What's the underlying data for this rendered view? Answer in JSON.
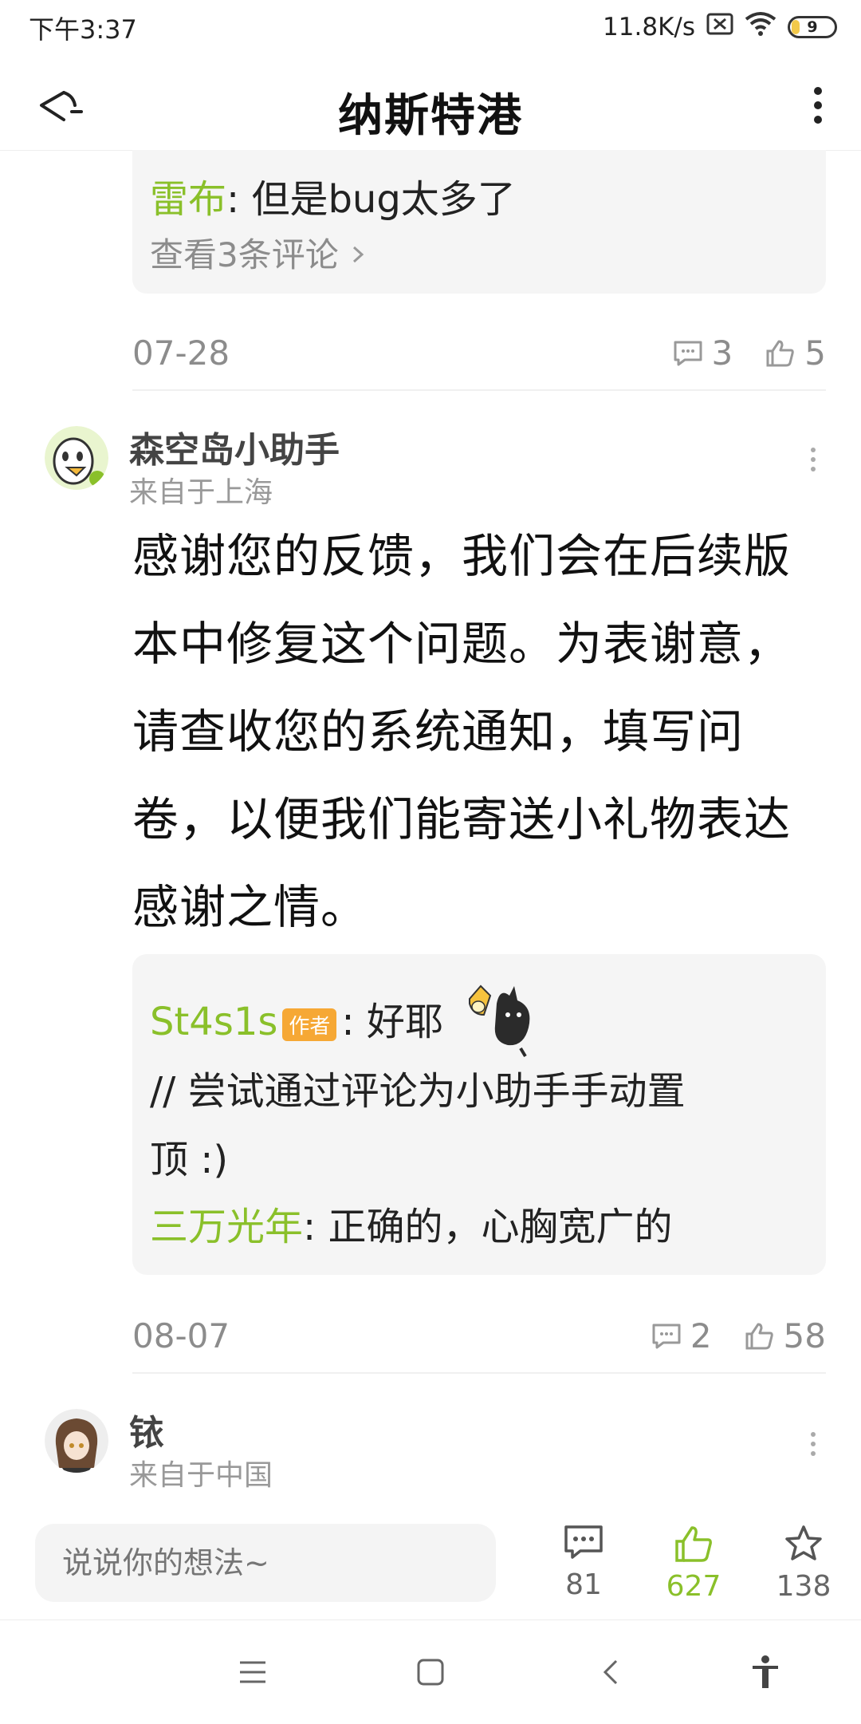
{
  "status_bar": {
    "time": "下午3:37",
    "net_speed": "11.8K/s",
    "battery": "9"
  },
  "header": {
    "title": "纳斯特港"
  },
  "reply_card_top": {
    "name": "雷布",
    "text": ": 但是bug太多了",
    "view_more": "查看3条评论"
  },
  "post_meta_1": {
    "date": "07-28",
    "comments": "3",
    "likes": "5"
  },
  "comment_1": {
    "username": "森空岛小助手",
    "location": "来自于上海",
    "lines": [
      "感谢您的反馈，我们会在后续版",
      "本中修复这个问题。为表谢意，",
      "请查收您的系统通知，填写问",
      "卷，以便我们能寄送小礼物表达",
      "感谢之情。"
    ],
    "replies": {
      "r1_name": "St4s1s",
      "r1_badge": "作者",
      "r1_text": ": 好耶",
      "r1_line2": "// 尝试通过评论为小助手手动置",
      "r1_line3": "顶 :)",
      "r2_name": "三万光年",
      "r2_text": ": 正确的，心胸宽广的"
    }
  },
  "post_meta_2": {
    "date": "08-07",
    "comments": "2",
    "likes": "58"
  },
  "comment_2": {
    "username": "铱",
    "location": "来自于中国"
  },
  "bottom_bar": {
    "placeholder": "说说你的想法~",
    "comments_count": "81",
    "likes_count": "627",
    "favorites_count": "138"
  },
  "colors": {
    "accent_green": "#8ac02a",
    "badge_orange": "#f6a835"
  }
}
